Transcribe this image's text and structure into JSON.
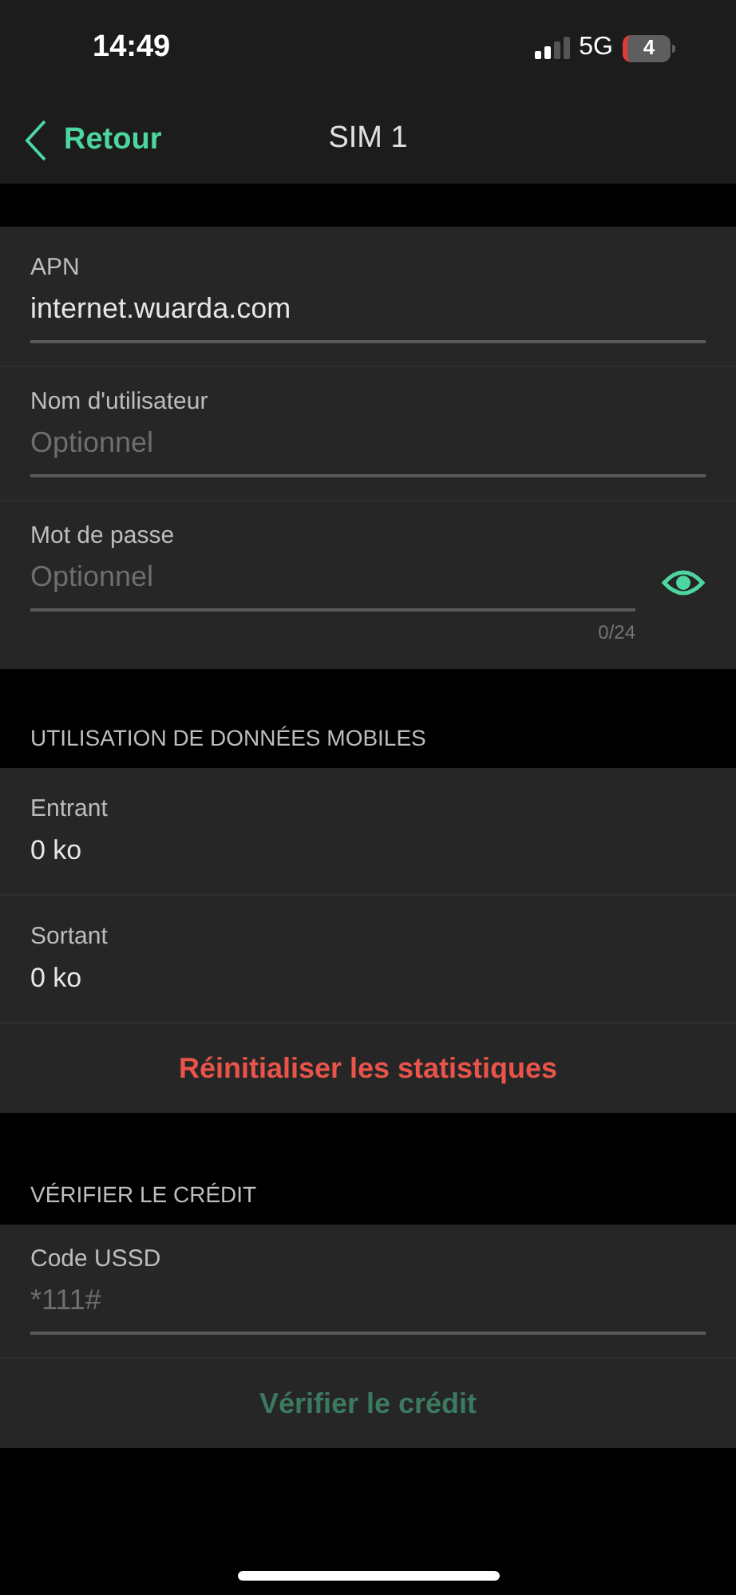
{
  "status_bar": {
    "time": "14:49",
    "network": "5G",
    "battery": "4"
  },
  "nav": {
    "back": "Retour",
    "title": "SIM 1"
  },
  "apn_fields": [
    {
      "label": "APN",
      "value": "internet.wuarda.com"
    },
    {
      "label": "Nom d'utilisateur",
      "placeholder": "Optionnel"
    },
    {
      "label": "Mot de passe",
      "placeholder": "Optionnel",
      "counter": "0/24",
      "kind": "password"
    }
  ],
  "data_usage": {
    "header": "UTILISATION DE DONNÉES MOBILES",
    "rows": [
      {
        "label": "Entrant",
        "value": "0 ko"
      },
      {
        "label": "Sortant",
        "value": "0 ko"
      }
    ],
    "reset_button": {
      "label": "Réinitialiser les statistiques",
      "disabled": false
    }
  },
  "credit": {
    "header": "VÉRIFIER LE CRÉDIT",
    "field": {
      "label": "Code USSD",
      "placeholder": "*111#"
    },
    "button": {
      "label": "Vérifier le crédit",
      "disabled": true
    }
  }
}
